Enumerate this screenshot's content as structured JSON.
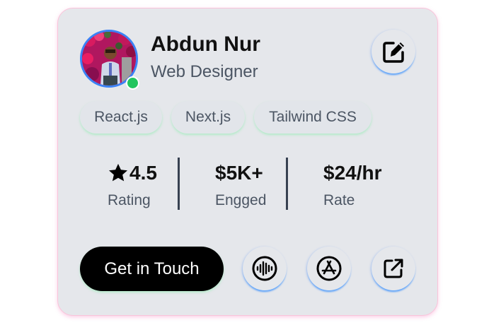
{
  "profile": {
    "name": "Abdun Nur",
    "role": "Web Designer",
    "avatar_icon": "person-photo",
    "online": true
  },
  "actions": {
    "edit_icon": "edit-icon"
  },
  "skills": [
    "React.js",
    "Next.js",
    "Tailwind CSS"
  ],
  "stats": [
    {
      "value": "4.5",
      "label": "Rating",
      "icon": "star-icon"
    },
    {
      "value": "$5K+",
      "label": "Engged"
    },
    {
      "value": "$24/hr",
      "label": "Rate"
    }
  ],
  "footer": {
    "cta_label": "Get in Touch",
    "icons": [
      "audio-wave-icon",
      "app-store-icon",
      "external-link-icon"
    ]
  },
  "colors": {
    "card_bg": "#e5e7eb",
    "card_border": "#f9c4da",
    "avatar_ring": "#3b82f6",
    "online": "#22c55e",
    "cta_bg": "#000000",
    "cta_text": "#ffffff",
    "text_primary": "#111111",
    "text_secondary": "#4b5563"
  }
}
